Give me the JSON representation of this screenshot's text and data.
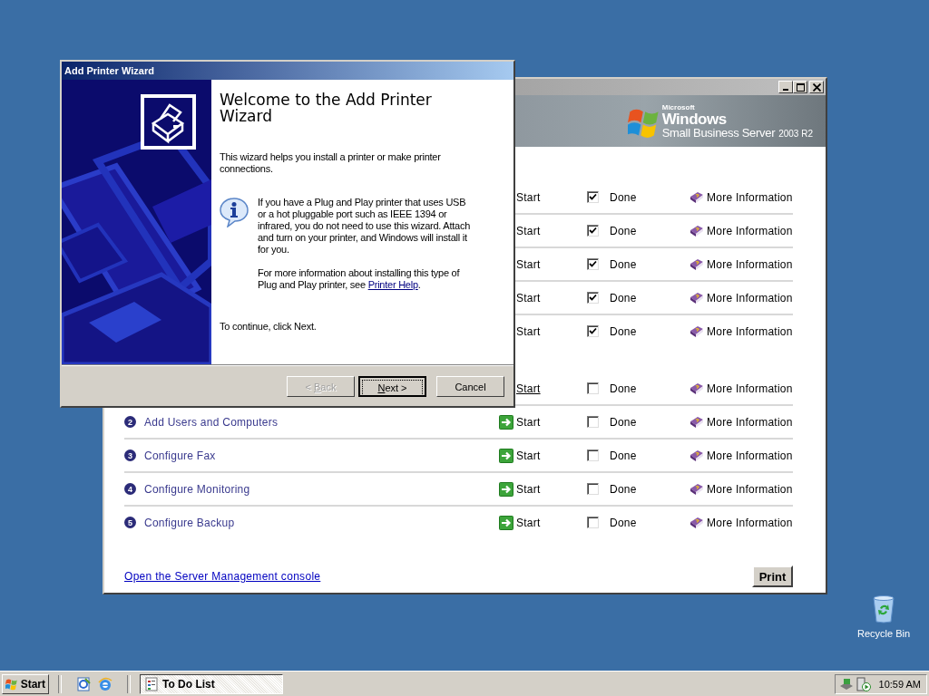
{
  "todo_window": {
    "banner": {
      "brand_small": "Microsoft",
      "product": "Windows",
      "edition": "Small Business Server",
      "version": "2003 R2"
    },
    "sections": [
      {
        "rows": [
          {
            "start_icon": false,
            "start": "Start",
            "hover": false,
            "done_label": "Done",
            "done": true,
            "info": "More Information"
          },
          {
            "start_icon": false,
            "start": "Start",
            "hover": false,
            "done_label": "Done",
            "done": true,
            "info": "More Information"
          },
          {
            "start_icon": false,
            "start": "Start",
            "hover": false,
            "done_label": "Done",
            "done": true,
            "info": "More Information"
          },
          {
            "start_icon": false,
            "start": "Start",
            "hover": false,
            "done_label": "Done",
            "done": true,
            "info": "More Information"
          },
          {
            "start_icon": false,
            "start": "Start",
            "hover": false,
            "done_label": "Done",
            "done": true,
            "info": "More Information"
          }
        ]
      },
      {
        "rows": [
          {
            "start_icon": false,
            "start": "Start",
            "hover": true,
            "done_label": "Done",
            "done": false,
            "info": "More Information"
          },
          {
            "number": "2",
            "name": "Add Users and Computers",
            "start_icon": true,
            "start": "Start",
            "hover": false,
            "done_label": "Done",
            "done": false,
            "info": "More Information"
          },
          {
            "number": "3",
            "name": "Configure Fax",
            "start_icon": true,
            "start": "Start",
            "hover": false,
            "done_label": "Done",
            "done": false,
            "info": "More Information"
          },
          {
            "number": "4",
            "name": "Configure Monitoring",
            "start_icon": true,
            "start": "Start",
            "hover": false,
            "done_label": "Done",
            "done": false,
            "info": "More Information"
          },
          {
            "number": "5",
            "name": "Configure Backup",
            "start_icon": true,
            "start": "Start",
            "hover": false,
            "done_label": "Done",
            "done": false,
            "info": "More Information"
          }
        ]
      }
    ],
    "console_link": "Open the Server Management console",
    "print_button": "Print"
  },
  "wizard": {
    "title": "Add Printer Wizard",
    "heading": "Welcome to the Add Printer Wizard",
    "intro": "This wizard helps you install a printer or make printer connections.",
    "info": "If you have a Plug and Play printer that uses USB or a hot pluggable port such as IEEE 1394 or infrared, you do not need to use this wizard. Attach and turn on your printer, and Windows will install it for you.",
    "more_info": {
      "before": "For more information about installing this type of Plug and Play printer, see ",
      "link": "Printer Help",
      "after": "."
    },
    "continue": "To continue, click Next.",
    "buttons": [
      {
        "before": "< ",
        "accel": "B",
        "after": "ack",
        "disabled": true,
        "default": false
      },
      {
        "accel": "N",
        "after": "ext >",
        "disabled": false,
        "default": true
      },
      {
        "after": "Cancel",
        "disabled": false,
        "default": false
      }
    ]
  },
  "desktop_icons": [
    {
      "label": "Recycle Bin"
    }
  ],
  "taskbar": {
    "start": "Start",
    "tasks": [
      {
        "label": "To Do List",
        "selected": true
      }
    ],
    "clock": "10:59 AM"
  }
}
